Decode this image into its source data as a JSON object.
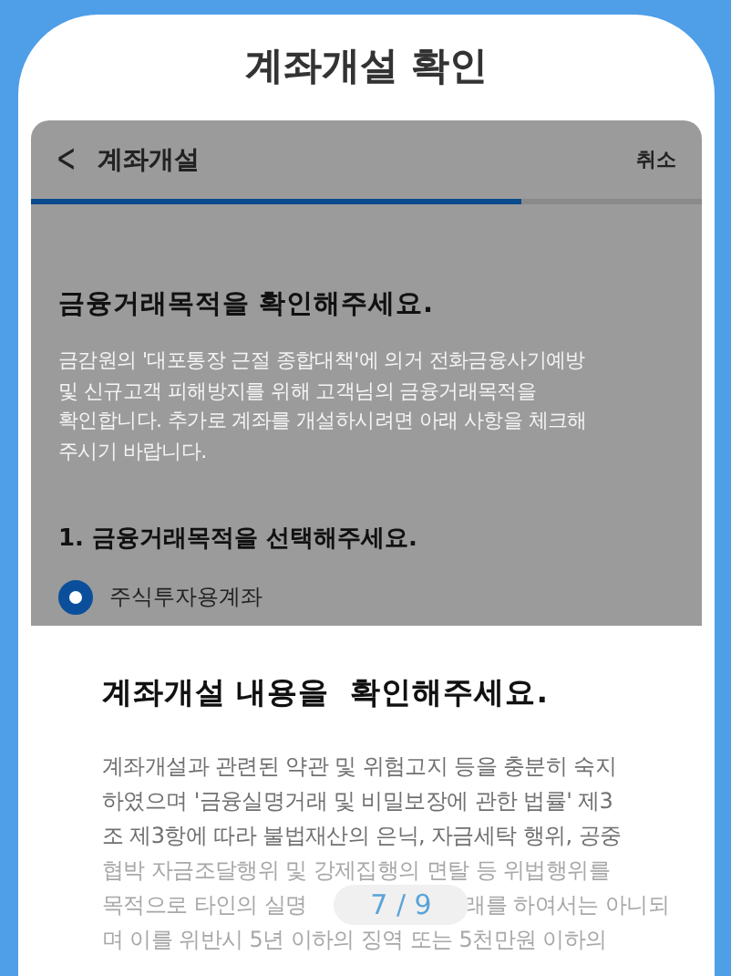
{
  "title": "계좌개설 확인",
  "app_header": {
    "back_icon": "<",
    "title": "계좌개설",
    "cancel": "취소"
  },
  "progress": {
    "level": 0.73
  },
  "heading": "금융거래목적을 확인해주세요.",
  "description": [
    "금감원의 '대포통장 근절 종합대책'에 의거 전화금융사기예방",
    "및 신규고객 피해방지를 위해 고객님의 금융거래목적을",
    "확인합니다. 추가로 계좌를 개설하시려면 아래 사항을 체크해",
    "주시기 바랍니다."
  ],
  "question": "1. 금융거래목적을 선택해주세요.",
  "options": [
    {
      "label": "주식투자용계좌",
      "selected": true
    }
  ],
  "sheet": {
    "heading": "계좌개설 내용을  확인해주세요.",
    "lines": [
      [
        "계좌개설과 관련된 약관 및 위험고지 등을 충분히 숙지"
      ],
      [
        "하였으며 '금융실명거래 및 비밀보장에 관한 법률' 제3"
      ],
      [
        "조 제3항에 따라 불법재산의 은닉, 자금세탁 행위, 공중"
      ],
      [
        "협박 자금조달행위 및 강제집행의 면탈 등 위법행위를"
      ],
      [
        "목적으로 타인의 실명",
        "래를 하여서는 아니되"
      ],
      [
        "며 이를 위반시 5년 이하의 징역 또는 5천만원 이하의"
      ]
    ]
  },
  "page_indicator": "7 / 9"
}
